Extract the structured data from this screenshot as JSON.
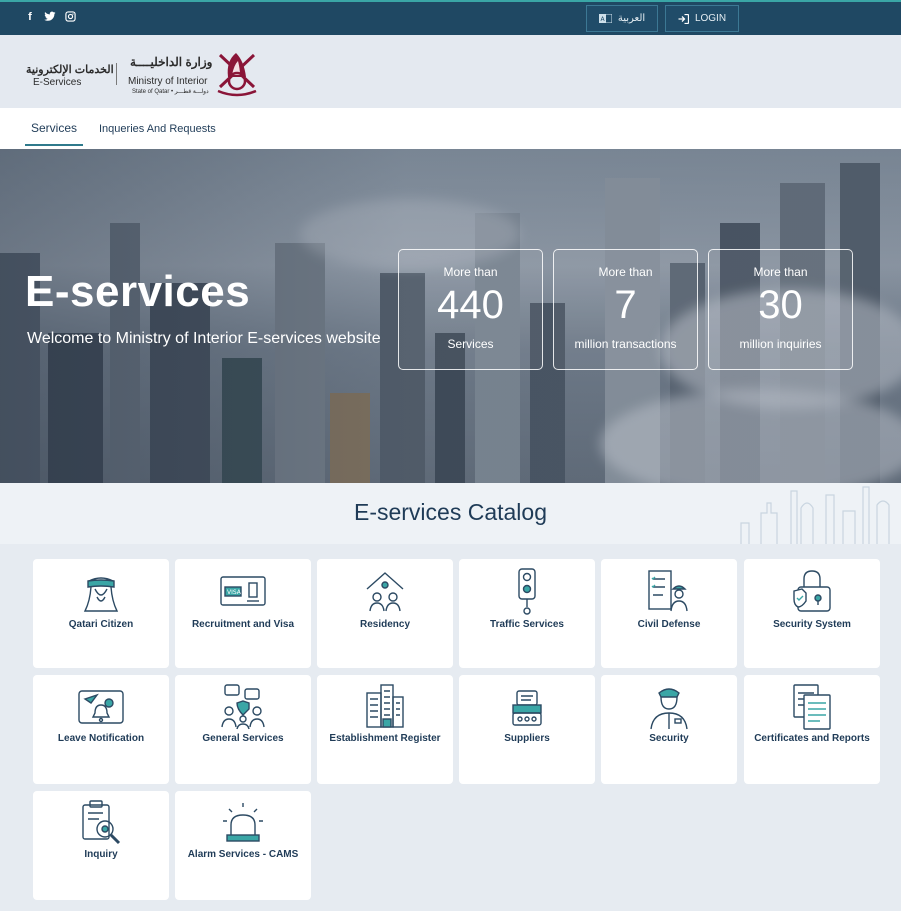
{
  "topbar": {
    "social": [
      "facebook-icon",
      "twitter-icon",
      "instagram-icon"
    ],
    "lang_label": "العربية",
    "login_label": "LOGIN"
  },
  "header": {
    "eservices_ar": "الخدمات الإلكترونية",
    "eservices_en": "E-Services",
    "moi_ar": "وزارة الداخليــــة",
    "moi_en": "Ministry of Interior",
    "state": "State of Qatar • دولـــة قطـــر"
  },
  "nav": {
    "items": [
      {
        "label": "Services",
        "active": true
      },
      {
        "label": "Inqueries And Requests",
        "active": false
      }
    ]
  },
  "hero": {
    "title": "E-services",
    "subtitle": "Welcome to Ministry of Interior E-services website",
    "stats": [
      {
        "pre": "More than",
        "num": "440",
        "post": "Services"
      },
      {
        "pre": "More than",
        "num": "7",
        "post": "million transactions"
      },
      {
        "pre": "More than",
        "num": "30",
        "post": "million inquiries"
      }
    ]
  },
  "catalog": {
    "title": "E-services Catalog",
    "cards": [
      {
        "label": "Qatari Citizen",
        "icon": "qatari-citizen-icon"
      },
      {
        "label": "Recruitment and Visa",
        "icon": "visa-icon"
      },
      {
        "label": "Residency",
        "icon": "residency-icon"
      },
      {
        "label": "Traffic Services",
        "icon": "traffic-light-icon"
      },
      {
        "label": "Civil Defense",
        "icon": "civil-defense-icon"
      },
      {
        "label": "Security System",
        "icon": "security-lock-icon"
      },
      {
        "label": "Leave Notification",
        "icon": "leave-notification-icon"
      },
      {
        "label": "General Services",
        "icon": "general-services-icon"
      },
      {
        "label": "Establishment Register",
        "icon": "building-icon"
      },
      {
        "label": "Suppliers",
        "icon": "suppliers-icon"
      },
      {
        "label": "Security",
        "icon": "police-officer-icon"
      },
      {
        "label": "Certificates and Reports",
        "icon": "documents-icon"
      },
      {
        "label": "Inquiry",
        "icon": "inquiry-icon"
      },
      {
        "label": "Alarm Services - CAMS",
        "icon": "alarm-icon"
      }
    ]
  },
  "colors": {
    "topbar": "#1f4863",
    "accent": "#3aa6a6",
    "maroon": "#8a1538",
    "text": "#1f3b57"
  }
}
